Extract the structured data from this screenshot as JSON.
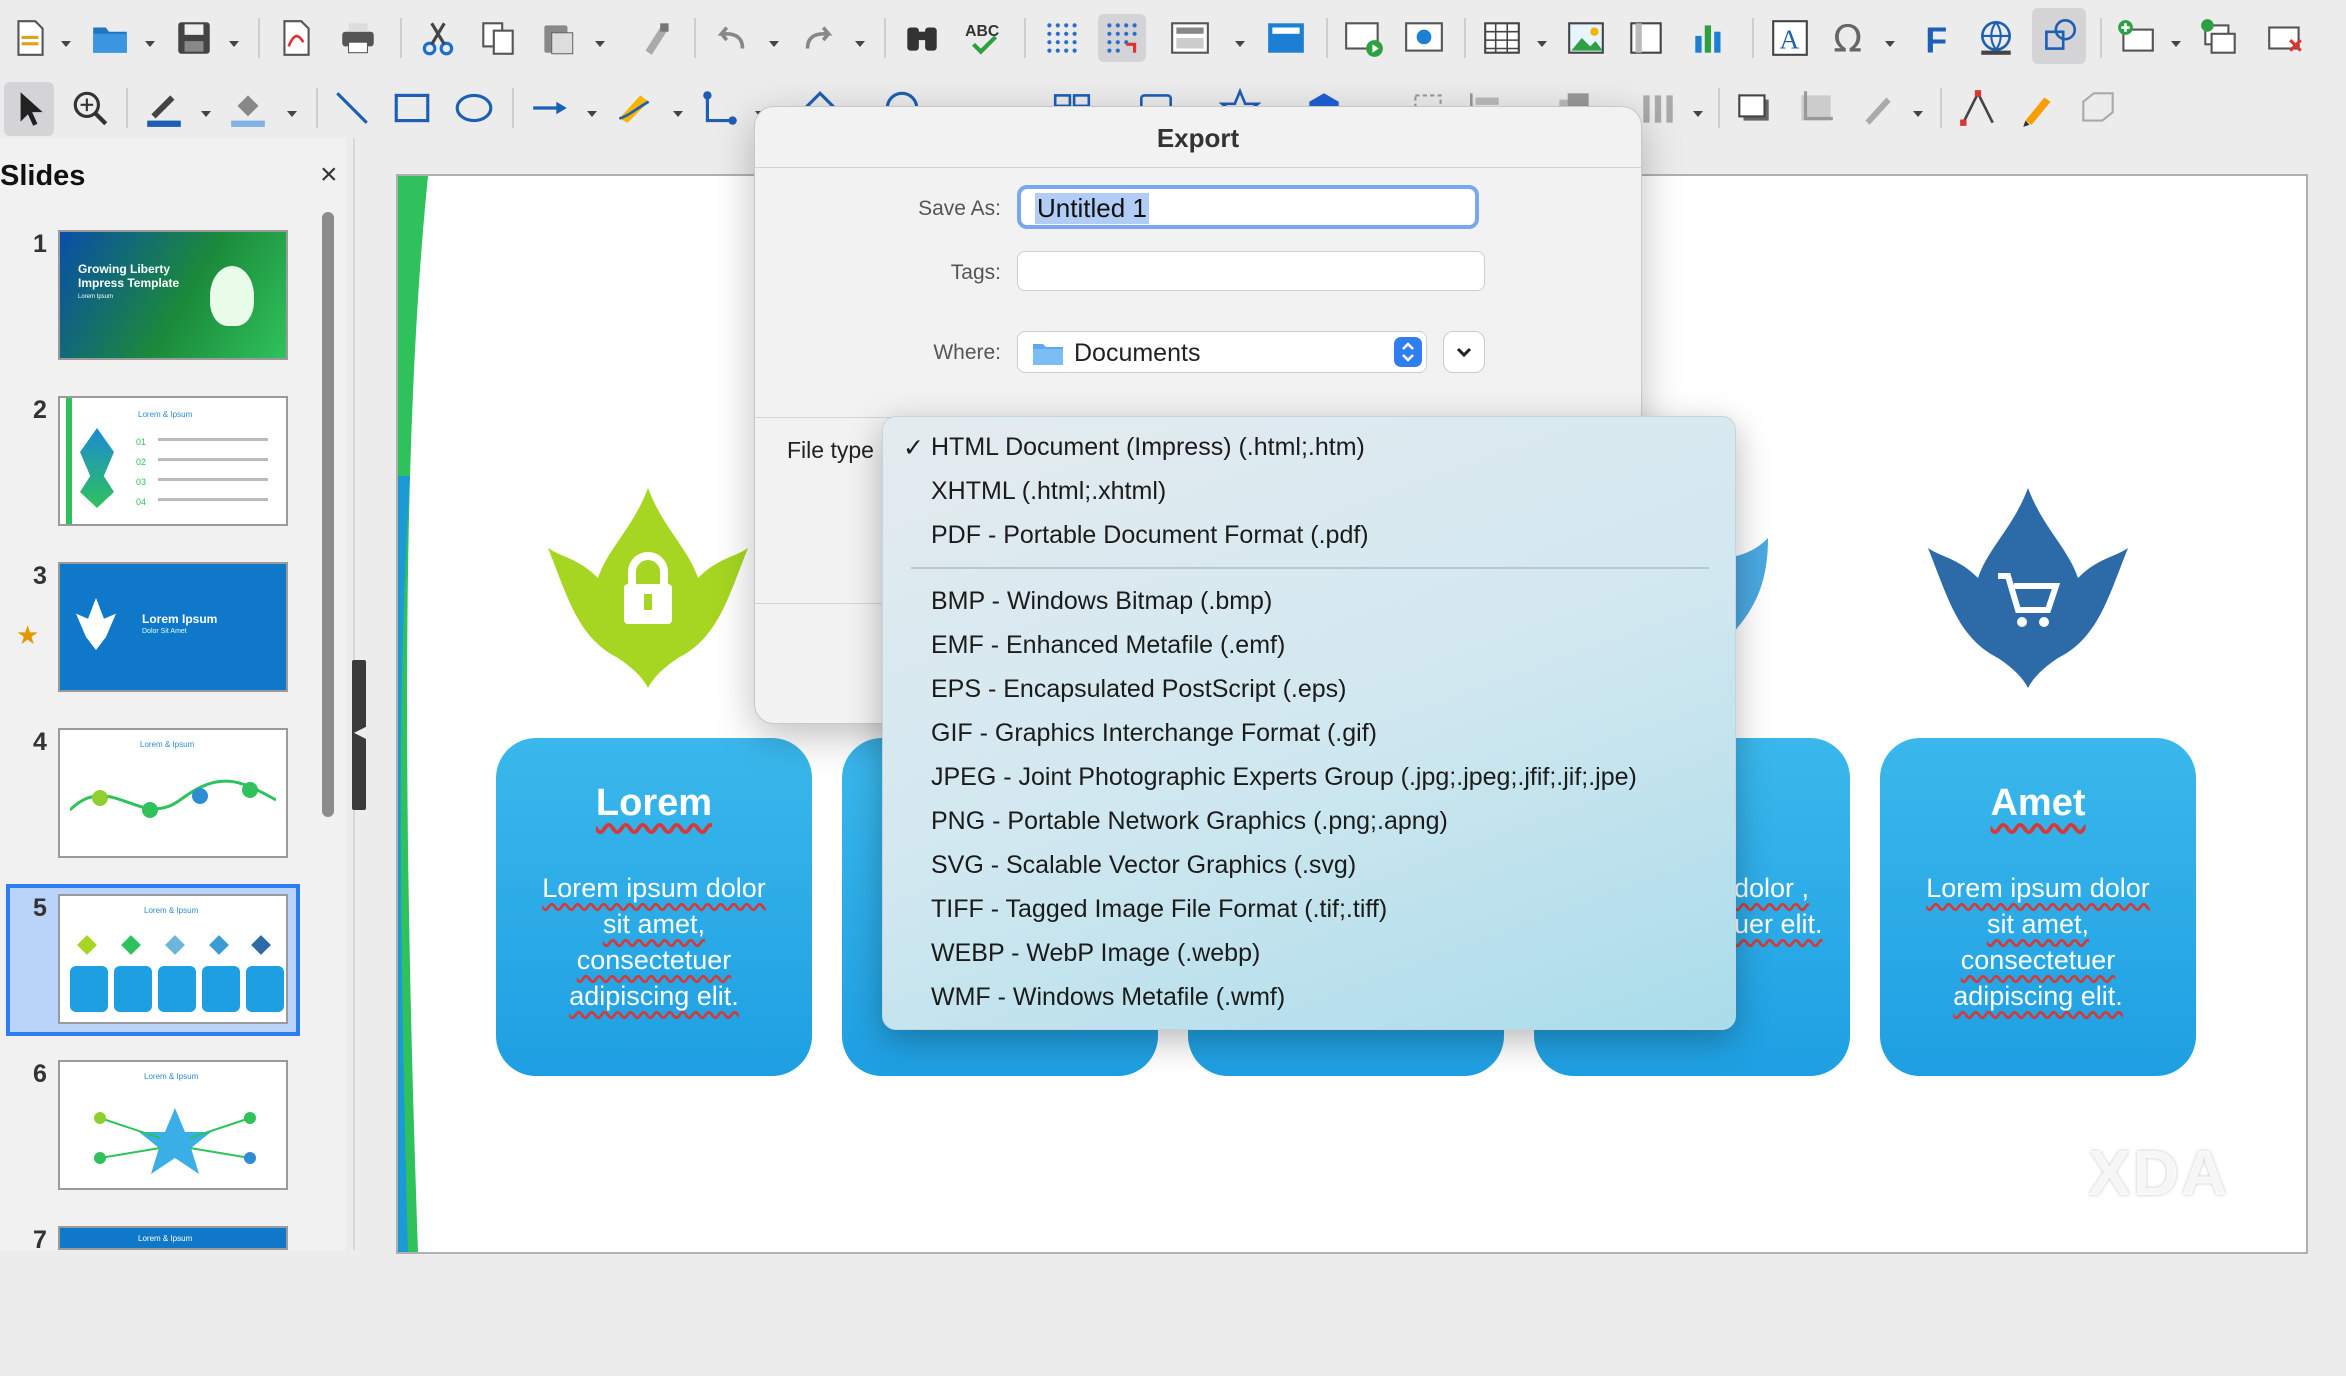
{
  "slides_pane": {
    "title": "Slides",
    "close": "×",
    "slides": [
      {
        "num": "1",
        "title": "Growing Liberty Impress Template",
        "subtitle": "Lorem Ipsum"
      },
      {
        "num": "2",
        "title": "Lorem & Ipsum",
        "items": [
          "01",
          "02",
          "03",
          "04"
        ]
      },
      {
        "num": "3",
        "title": "Lorem Ipsum",
        "subtitle": "Dolor Sit Amet"
      },
      {
        "num": "4",
        "title": "Lorem & Ipsum"
      },
      {
        "num": "5",
        "title": "Lorem & Ipsum"
      },
      {
        "num": "6",
        "title": "Lorem & Ipsum"
      },
      {
        "num": "7",
        "title": "Lorem & Ipsum"
      }
    ]
  },
  "slide": {
    "blocks": [
      {
        "title": "Lorem",
        "text": "Lorem ipsum dolor sit amet, consectetuer adipiscing elit."
      },
      {
        "title": "",
        "text": ""
      },
      {
        "title": "",
        "text": ""
      },
      {
        "title": "",
        "text": "dolor , uer elit."
      },
      {
        "title": "Amet",
        "text": "Lorem ipsum dolor sit amet, consectetuer adipiscing elit."
      }
    ]
  },
  "dialog": {
    "title": "Export",
    "save_as_label": "Save As:",
    "save_as_value": "Untitled 1",
    "tags_label": "Tags:",
    "tags_value": "",
    "where_label": "Where:",
    "where_value": "Documents",
    "file_type_label": "File type"
  },
  "file_types": {
    "selected": "HTML Document (Impress) (.html;.htm)",
    "check": "✓",
    "group1": [
      "HTML Document (Impress) (.html;.htm)",
      "XHTML (.html;.xhtml)",
      "PDF - Portable Document Format (.pdf)"
    ],
    "group2": [
      "BMP - Windows Bitmap (.bmp)",
      "EMF - Enhanced Metafile (.emf)",
      "EPS - Encapsulated PostScript (.eps)",
      "GIF - Graphics Interchange Format (.gif)",
      "JPEG - Joint Photographic Experts Group (.jpg;.jpeg;.jfif;.jif;.jpe)",
      "PNG - Portable Network Graphics (.png;.apng)",
      "SVG - Scalable Vector Graphics (.svg)",
      "TIFF - Tagged Image File Format (.tif;.tiff)",
      "WEBP - WebP Image (.webp)",
      "WMF - Windows Metafile (.wmf)"
    ]
  },
  "colors": {
    "accent_blue": "#2f7ef0",
    "block_blue": "#1e9fe2",
    "leaf_green": "#a6d622",
    "leaf_navy": "#2c6aa8",
    "toolbar_bg": "#ececec"
  },
  "watermark": "XDA"
}
